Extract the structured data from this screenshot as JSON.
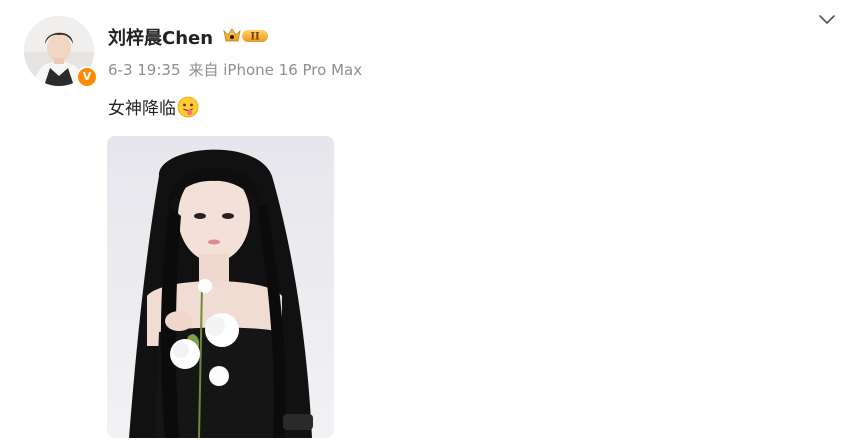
{
  "post": {
    "author": {
      "name": "刘梓晨Chen",
      "vip_level": "II",
      "verified_mark": "V"
    },
    "time": "6-3 19:35",
    "source": "来自 iPhone 16 Pro Max",
    "text": "女神降临",
    "emoji": "tongue-out-emoji",
    "image": "portrait-photo"
  },
  "icons": {
    "more": "chevron-down-icon",
    "vip": "crown-badge-icon"
  },
  "colors": {
    "verified": "#ff8a00",
    "vip_gold": "#f3b23a",
    "meta_text": "#8f8f8f"
  }
}
